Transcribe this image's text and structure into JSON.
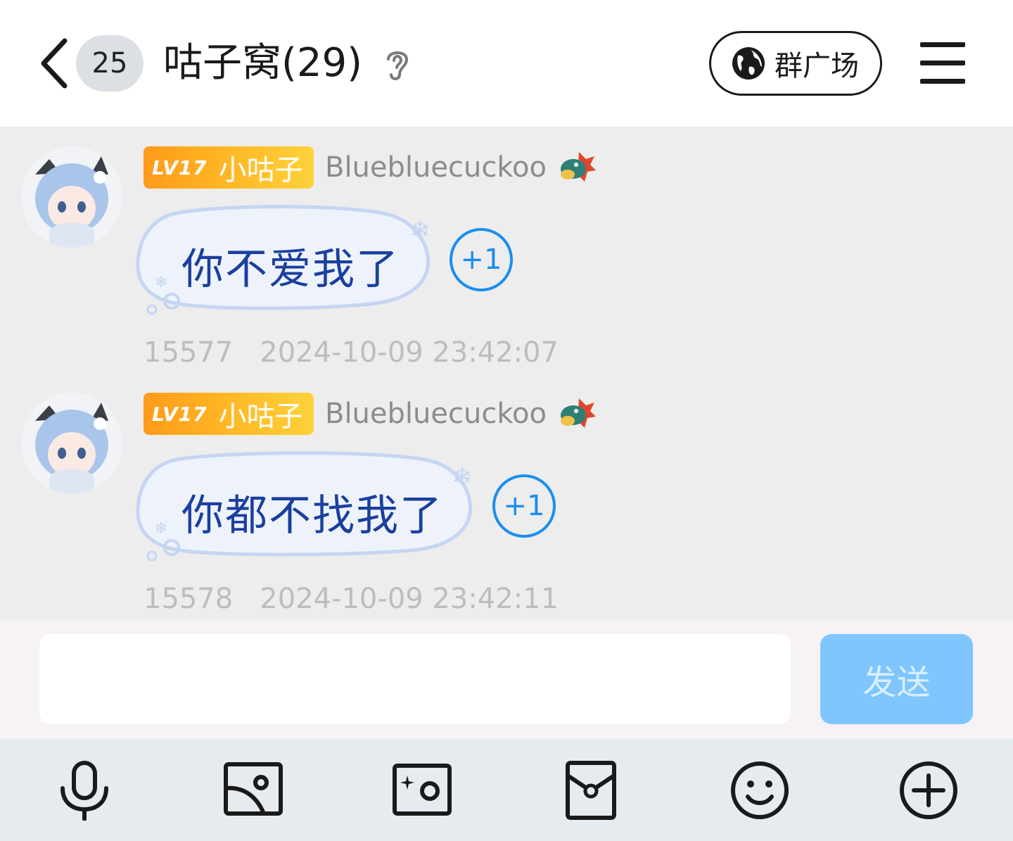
{
  "header": {
    "unread_count": "25",
    "group_title": "咕子窝(29)",
    "square_label": "群广场"
  },
  "messages": [
    {
      "level": "LV17",
      "rank": "小咕子",
      "nickname": "Bluebluecuckoo",
      "text": "你不爱我了",
      "plus": "+1",
      "seq": "15577",
      "time": "2024-10-09 23:42:07"
    },
    {
      "level": "LV17",
      "rank": "小咕子",
      "nickname": "Bluebluecuckoo",
      "text": "你都不找我了",
      "plus": "+1",
      "seq": "15578",
      "time": "2024-10-09 23:42:11"
    }
  ],
  "composer": {
    "input_value": "",
    "send_label": "发送"
  },
  "toolbar": {
    "icons": [
      "microphone-icon",
      "image-icon",
      "camera-icon",
      "red-packet-icon",
      "emoji-icon",
      "plus-icon"
    ]
  },
  "colors": {
    "accent_blue": "#1a8ef0",
    "send_button": "#7fc6ff",
    "bubble_text": "#1a3f9e",
    "badge_orange": "#ff9a1a",
    "badge_yellow": "#ffd23a"
  }
}
